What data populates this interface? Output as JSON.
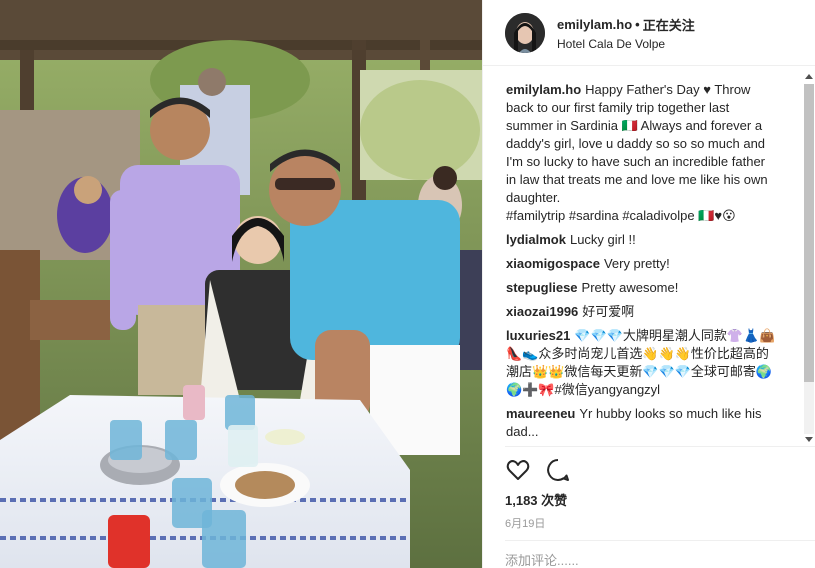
{
  "header": {
    "username": "emilylam.ho",
    "separator": "•",
    "follow_status": "正在关注",
    "location": "Hotel Cala De Volpe"
  },
  "caption": {
    "username": "emilylam.ho",
    "text": "Happy Father's Day ♥ Throw back to our first family trip together last summer in Sardinia 🇮🇹 Always and forever a daddy's girl, love u daddy so so so much and I'm so lucky to have such an incredible father in law that treats me and love me like his own daughter.",
    "hashtags": "#familytrip #sardina #caladivolpe 🇮🇹♥😮"
  },
  "comments": [
    {
      "username": "lydialmok",
      "text": "Lucky girl !!"
    },
    {
      "username": "xiaomigospace",
      "text": "Very pretty!"
    },
    {
      "username": "stepugliese",
      "text": "Pretty awesome!"
    },
    {
      "username": "xiaozai1996",
      "text": "好可爱啊"
    },
    {
      "username": "luxuries21",
      "text": "💎💎💎大牌明星潮人同款👚👗👜👠👟众多时尚宠儿首选👋👋👋性价比超高的潮店👑👑微信每天更新💎💎💎全球可邮寄🌍🌍➕🎀#微信yangyangzyl"
    },
    {
      "username": "maureeneu",
      "text": "Yr hubby looks so much like his dad..."
    }
  ],
  "actions": {
    "like_icon": "heart-outline-icon",
    "comment_icon": "speech-bubble-icon"
  },
  "likes": "1,183 次赞",
  "date": "6月19日",
  "add_comment_placeholder": "添加评论......",
  "colors": {
    "text": "#262626",
    "muted": "#999999",
    "border": "#efefef"
  }
}
